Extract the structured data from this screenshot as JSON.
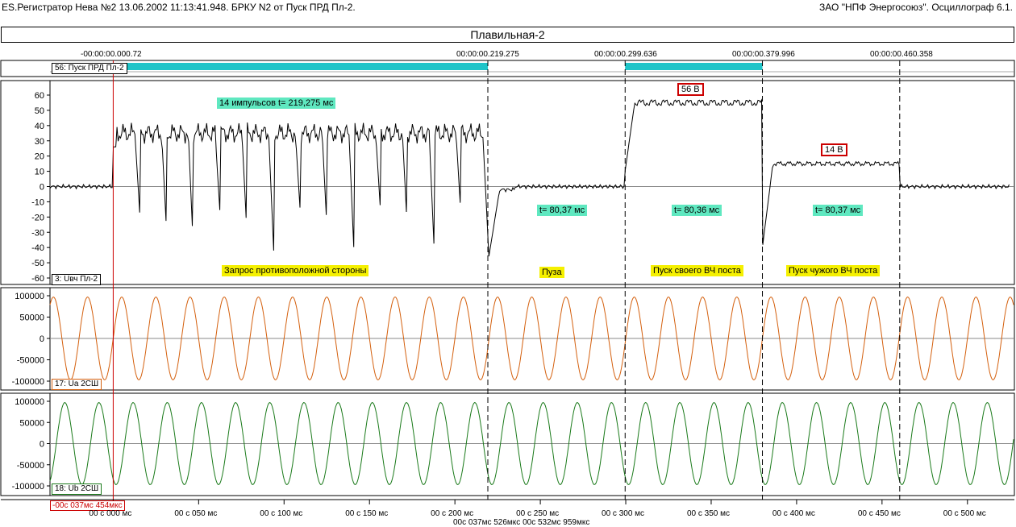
{
  "header": {
    "left": "ES.Регистратор Нева №2 13.06.2002 11:13:41.948. БРКУ N2 от Пуск ПРД  Пл-2.",
    "right": "ЗАО \"НПФ Энергосоюз\". Осциллограф 6.1."
  },
  "title": "Плавильная-2",
  "top_times": [
    "-00:00:00.000.72",
    "00:00:00.219.275",
    "00:00:00.299.636",
    "00:00:00.379.996",
    "00:00:00.460.358"
  ],
  "digital_channel": {
    "label": "56: Пуск ПРД  Пл-2",
    "on_ms": [
      [
        0,
        219.3
      ],
      [
        299.6,
        380.0
      ]
    ],
    "color": "#1fc4c8"
  },
  "channels": [
    {
      "label": "3: Uвч Пл-2",
      "color": "#000000",
      "ylim": [
        -65,
        65
      ],
      "ticks": [
        60,
        50,
        40,
        30,
        20,
        10,
        0,
        -10,
        -20,
        -30,
        -40,
        -50,
        -60
      ]
    },
    {
      "label": "17: Ua 2СШ",
      "color": "#d4600e",
      "ylim": [
        -110000,
        110000
      ],
      "ticks": [
        100000,
        50000,
        0,
        -50000,
        -100000
      ],
      "amplitude": 97000,
      "freq_hz": 50,
      "phase_deg": 0
    },
    {
      "label": "18: Ub 2СШ",
      "color": "#1a7a1a",
      "ylim": [
        -110000,
        110000
      ],
      "ticks": [
        100000,
        50000,
        0,
        -50000,
        -100000
      ],
      "amplitude": 97000,
      "freq_hz": 50,
      "phase_deg": -120
    }
  ],
  "annotations": {
    "impulses": "14 импульсов  t= 219,275 мс",
    "t1": "t= 80,37 мс",
    "t2": "t= 80,36 мс",
    "t3": "t= 80,37 мс",
    "v56": "56 В",
    "v14": "14 В",
    "zapros": "Запрос противоположной стороны",
    "pauza": "Пуза",
    "pusk_own": "Пуск своего ВЧ поста",
    "pusk_other": "Пуск чужого ВЧ поста"
  },
  "segments_ms": [
    0,
    219.275,
    299.636,
    379.996,
    460.358
  ],
  "cursor": {
    "label": "-00с 037мс 454мкс",
    "time_ms": 0,
    "color": "#cc0000"
  },
  "time_axis": {
    "range_ms": [
      -37,
      527
    ],
    "labels": [
      "00 с 000 мс",
      "00 с 050 мс",
      "00 с 100 мс",
      "00 с 150 мс",
      "00 с 200 мс",
      "00 с 250 мс",
      "00 с 300 мс",
      "00 с 350 мс",
      "00 с 400 мс",
      "00 с 450 мс",
      "00 с 500 мс"
    ],
    "values_ms": [
      0,
      50,
      100,
      150,
      200,
      250,
      300,
      350,
      400,
      450,
      500
    ],
    "footer": "00с 037мс 526мкс   00с 532мс 959мкс"
  }
}
